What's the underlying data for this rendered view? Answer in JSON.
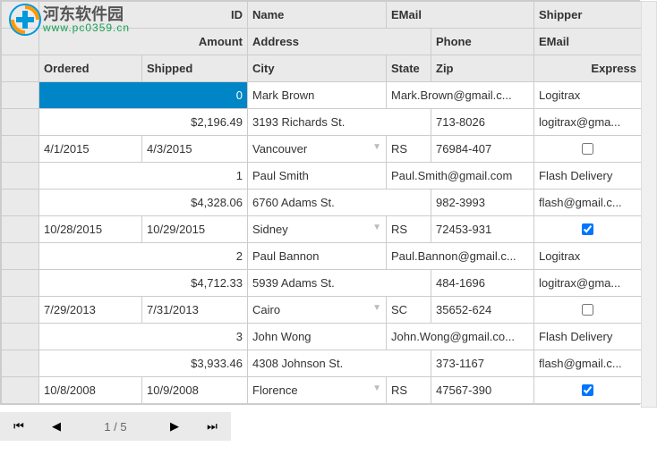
{
  "watermark": {
    "text1": "河东软件园",
    "text2": "www.pc0359.cn"
  },
  "headers": {
    "row1": {
      "id": "ID",
      "name": "Name",
      "email": "EMail",
      "shipper": "Shipper"
    },
    "row2": {
      "amount": "Amount",
      "address": "Address",
      "phone": "Phone",
      "email": "EMail"
    },
    "row3": {
      "ordered": "Ordered",
      "shipped": "Shipped",
      "city": "City",
      "state": "State",
      "zip": "Zip",
      "express": "Express"
    }
  },
  "rows": [
    {
      "id": "0",
      "name": "Mark Brown",
      "email": "Mark.Brown@gmail.c...",
      "shipper": "Logitrax",
      "amount": "$2,196.49",
      "address": "3193 Richards St.",
      "phone": "713-8026",
      "shipper_email": "logitrax@gma...",
      "ordered": "4/1/2015",
      "shipped": "4/3/2015",
      "city": "Vancouver",
      "state": "RS",
      "zip": "76984-407",
      "express": false,
      "selected": true
    },
    {
      "id": "1",
      "name": "Paul Smith",
      "email": "Paul.Smith@gmail.com",
      "shipper": "Flash Delivery",
      "amount": "$4,328.06",
      "address": "6760 Adams St.",
      "phone": "982-3993",
      "shipper_email": "flash@gmail.c...",
      "ordered": "10/28/2015",
      "shipped": "10/29/2015",
      "city": "Sidney",
      "state": "RS",
      "zip": "72453-931",
      "express": true,
      "selected": false
    },
    {
      "id": "2",
      "name": "Paul Bannon",
      "email": "Paul.Bannon@gmail.c...",
      "shipper": "Logitrax",
      "amount": "$4,712.33",
      "address": "5939 Adams St.",
      "phone": "484-1696",
      "shipper_email": "logitrax@gma...",
      "ordered": "7/29/2013",
      "shipped": "7/31/2013",
      "city": "Cairo",
      "state": "SC",
      "zip": "35652-624",
      "express": false,
      "selected": false
    },
    {
      "id": "3",
      "name": "John Wong",
      "email": "John.Wong@gmail.co...",
      "shipper": "Flash Delivery",
      "amount": "$3,933.46",
      "address": "4308 Johnson St.",
      "phone": "373-1167",
      "shipper_email": "flash@gmail.c...",
      "ordered": "10/8/2008",
      "shipped": "10/9/2008",
      "city": "Florence",
      "state": "RS",
      "zip": "47567-390",
      "express": true,
      "selected": false
    }
  ],
  "pager": {
    "page_label": "1 / 5"
  }
}
